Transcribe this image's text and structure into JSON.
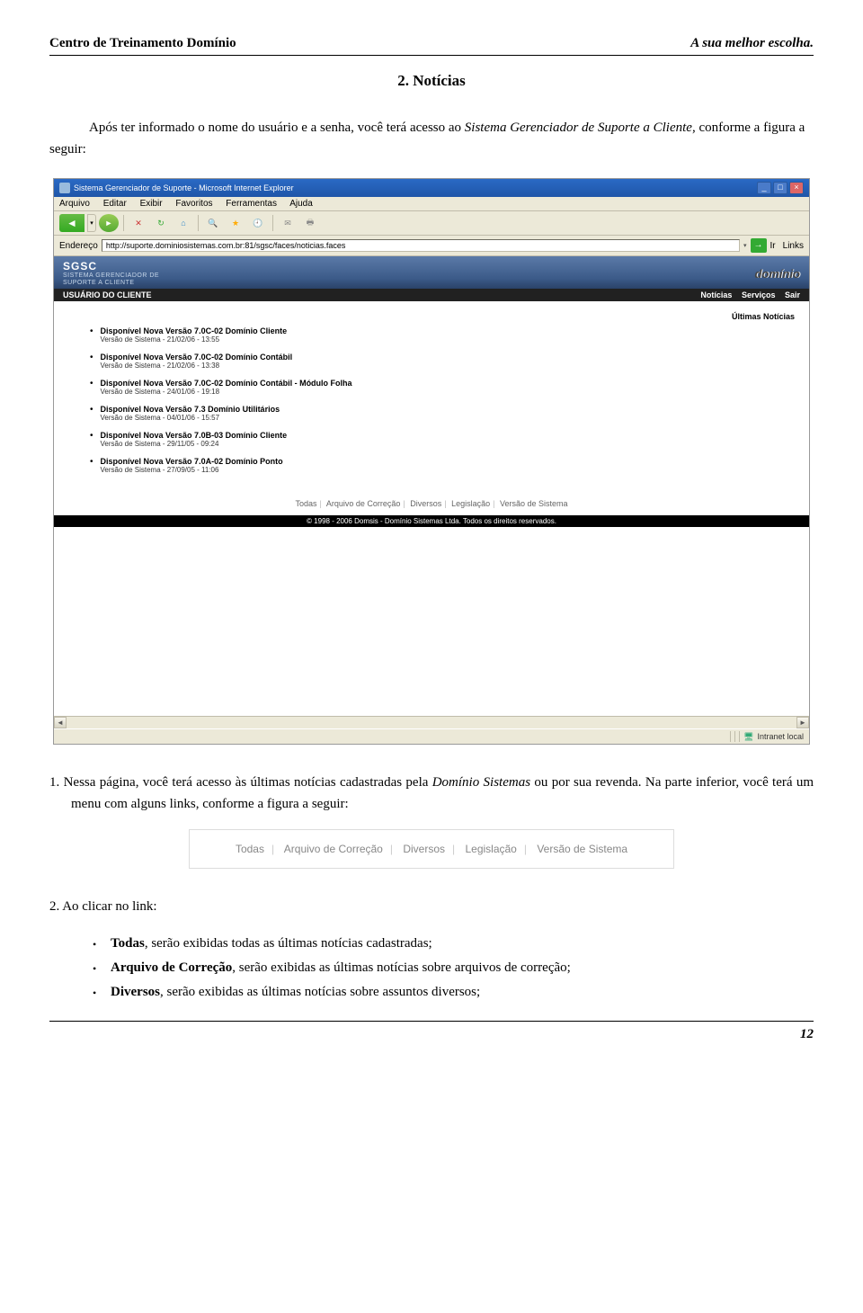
{
  "header": {
    "left": "Centro de Treinamento Domínio",
    "right": "A sua melhor escolha."
  },
  "section_title": "2. Notícias",
  "intro": {
    "p1a": "Após ter informado o nome do usuário e a senha, você terá acesso ao ",
    "p1b": "Sistema Gerenciador de Suporte a Cliente",
    "p1c": ", conforme a figura a seguir:"
  },
  "browser": {
    "title": "Sistema Gerenciador de Suporte - Microsoft Internet Explorer",
    "menus": {
      "arquivo": "Arquivo",
      "editar": "Editar",
      "exibir": "Exibir",
      "favoritos": "Favoritos",
      "ferramentas": "Ferramentas",
      "ajuda": "Ajuda"
    },
    "address_label": "Endereço",
    "address": "http://suporte.dominiosistemas.com.br:81/sgsc/faces/noticias.faces",
    "ir": "Ir",
    "links": "Links",
    "sgsc": {
      "brand": "SGSC",
      "line1": "SISTEMA GERENCIADOR DE",
      "line2": "SUPORTE A CLIENTE",
      "rightlogo": "domínio"
    },
    "topnav": {
      "left": "USUÁRIO DO CLIENTE",
      "r1": "Notícias",
      "r2": "Serviços",
      "r3": "Sair"
    },
    "page_header": "Últimas Notícias",
    "news": [
      {
        "title": "Disponível Nova Versão 7.0C-02 Domínio Cliente",
        "date": "Versão de Sistema - 21/02/06 - 13:55"
      },
      {
        "title": "Disponível Nova Versão 7.0C-02 Domínio Contábil",
        "date": "Versão de Sistema - 21/02/06 - 13:38"
      },
      {
        "title": "Disponível Nova Versão 7.0C-02 Domínio Contábil - Módulo Folha",
        "date": "Versão de Sistema - 24/01/06 - 19:18"
      },
      {
        "title": "Disponível Nova Versão 7.3 Domínio Utilitários",
        "date": "Versão de Sistema - 04/01/06 - 15:57"
      },
      {
        "title": "Disponível Nova Versão 7.0B-03 Domínio Cliente",
        "date": "Versão de Sistema - 29/11/05 - 09:24"
      },
      {
        "title": "Disponível Nova Versão 7.0A-02 Domínio Ponto",
        "date": "Versão de Sistema - 27/09/05 - 11:06"
      }
    ],
    "bottom_links": {
      "todas": "Todas",
      "arquivo": "Arquivo de Correção",
      "diversos": "Diversos",
      "legislacao": "Legislação",
      "versao": "Versão de Sistema"
    },
    "copyright": "© 1998 - 2006 Domsis - Domínio Sistemas Ltda. Todos os direitos reservados.",
    "status": "Intranet local",
    "win_min": "_",
    "win_max": "□",
    "win_close": "×"
  },
  "num_item1": {
    "num": "1.",
    "a": "Nessa página, você terá acesso às últimas notícias cadastradas pela ",
    "b": "Domínio Sistemas",
    "c": " ou por sua revenda. Na parte inferior, você terá um menu com alguns links, conforme a figura a seguir:"
  },
  "menu_fig": {
    "todas": "Todas",
    "arquivo": "Arquivo de Correção",
    "diversos": "Diversos",
    "legislacao": "Legislação",
    "versao": "Versão de Sistema"
  },
  "num_item2": {
    "num": "2.",
    "text": "Ao clicar no link:"
  },
  "bullets": {
    "b1a": "Todas",
    "b1b": ", serão exibidas todas as últimas notícias cadastradas;",
    "b2a": "Arquivo de Correção",
    "b2b": ", serão exibidas as últimas notícias sobre arquivos de correção;",
    "b3a": "Diversos",
    "b3b": ", serão exibidas as últimas notícias sobre assuntos diversos;"
  },
  "page_number": "12"
}
